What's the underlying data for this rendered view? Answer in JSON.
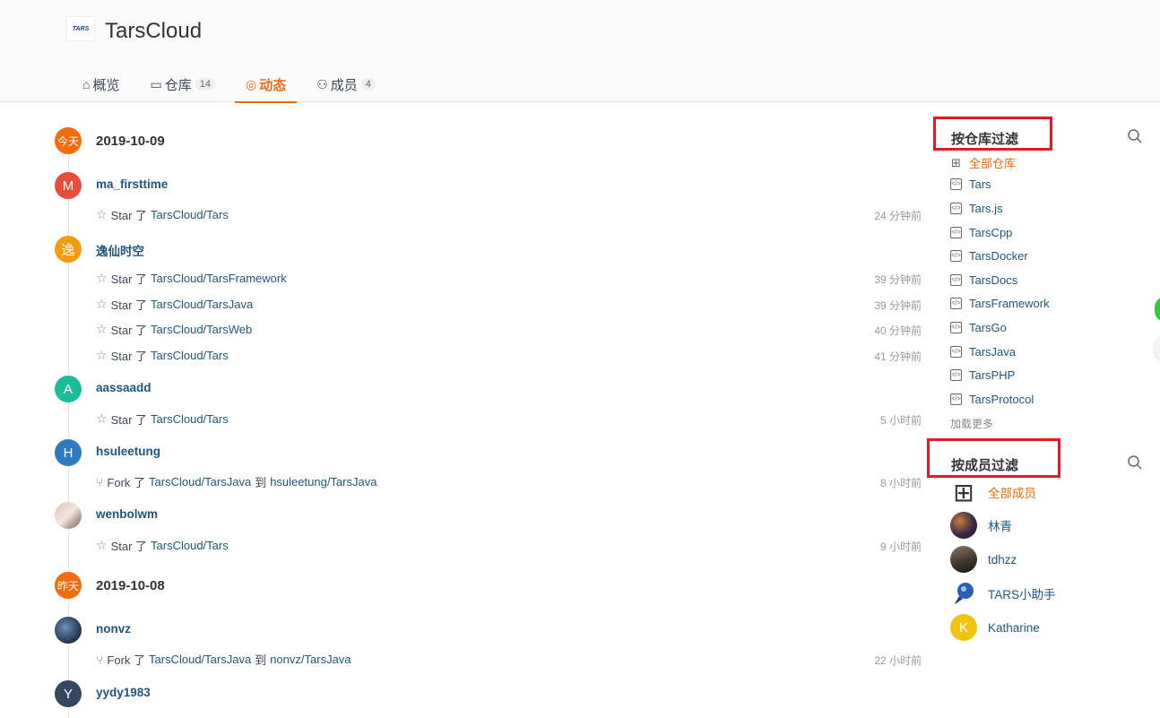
{
  "org": {
    "logo_text": "TARS",
    "name": "TarsCloud"
  },
  "tabs": [
    {
      "label": "概览",
      "count": ""
    },
    {
      "label": "仓库",
      "count": "14"
    },
    {
      "label": "动态",
      "count": ""
    },
    {
      "label": "成员",
      "count": "4"
    }
  ],
  "feed": {
    "day1": {
      "badge": "今天",
      "date": "2019-10-09"
    },
    "day2": {
      "badge": "昨天",
      "date": "2019-10-08"
    },
    "users": [
      {
        "initial": "M",
        "name": "ma_firsttime"
      },
      {
        "initial": "逸",
        "name": "逸仙时空"
      },
      {
        "initial": "A",
        "name": "aassaadd"
      },
      {
        "initial": "H",
        "name": "hsuleetung"
      },
      {
        "initial": "",
        "name": "wenbolwm"
      },
      {
        "initial": "",
        "name": "nonvz"
      },
      {
        "initial": "Y",
        "name": "yydy1983"
      }
    ],
    "actions": [
      {
        "verb": "Star 了",
        "repo": "TarsCloud/Tars",
        "to": "",
        "target": "",
        "time": "24 分钟前"
      },
      {
        "verb": "Star 了",
        "repo": "TarsCloud/TarsFramework",
        "to": "",
        "target": "",
        "time": "39 分钟前"
      },
      {
        "verb": "Star 了",
        "repo": "TarsCloud/TarsJava",
        "to": "",
        "target": "",
        "time": "39 分钟前"
      },
      {
        "verb": "Star 了",
        "repo": "TarsCloud/TarsWeb",
        "to": "",
        "target": "",
        "time": "40 分钟前"
      },
      {
        "verb": "Star 了",
        "repo": "TarsCloud/Tars",
        "to": "",
        "target": "",
        "time": "41 分钟前"
      },
      {
        "verb": "Star 了",
        "repo": "TarsCloud/Tars",
        "to": "",
        "target": "",
        "time": "5 小时前"
      },
      {
        "verb": "Fork 了",
        "repo": "TarsCloud/TarsJava",
        "to": "到",
        "target": "hsuleetung/TarsJava",
        "time": "8 小时前"
      },
      {
        "verb": "Star 了",
        "repo": "TarsCloud/Tars",
        "to": "",
        "target": "",
        "time": "9 小时前"
      },
      {
        "verb": "Fork 了",
        "repo": "TarsCloud/TarsJava",
        "to": "到",
        "target": "nonvz/TarsJava",
        "time": "22 小时前"
      }
    ]
  },
  "sidebar": {
    "repo_filter": {
      "title": "按仓库过滤",
      "items": [
        "全部仓库",
        "Tars",
        "Tars.js",
        "TarsCpp",
        "TarsDocker",
        "TarsDocs",
        "TarsFramework",
        "TarsGo",
        "TarsJava",
        "TarsPHP",
        "TarsProtocol"
      ],
      "more": "加载更多"
    },
    "member_filter": {
      "title": "按成员过滤",
      "items": [
        {
          "name": "全部成员",
          "initial": ""
        },
        {
          "name": "林青",
          "initial": ""
        },
        {
          "name": "tdhzz",
          "initial": ""
        },
        {
          "name": "TARS小助手",
          "initial": ""
        },
        {
          "name": "Katharine",
          "initial": "K"
        }
      ]
    }
  },
  "colors": {
    "accent": "#f26b0d",
    "link": "#1f5680",
    "highlight_box": "#e01b24"
  }
}
